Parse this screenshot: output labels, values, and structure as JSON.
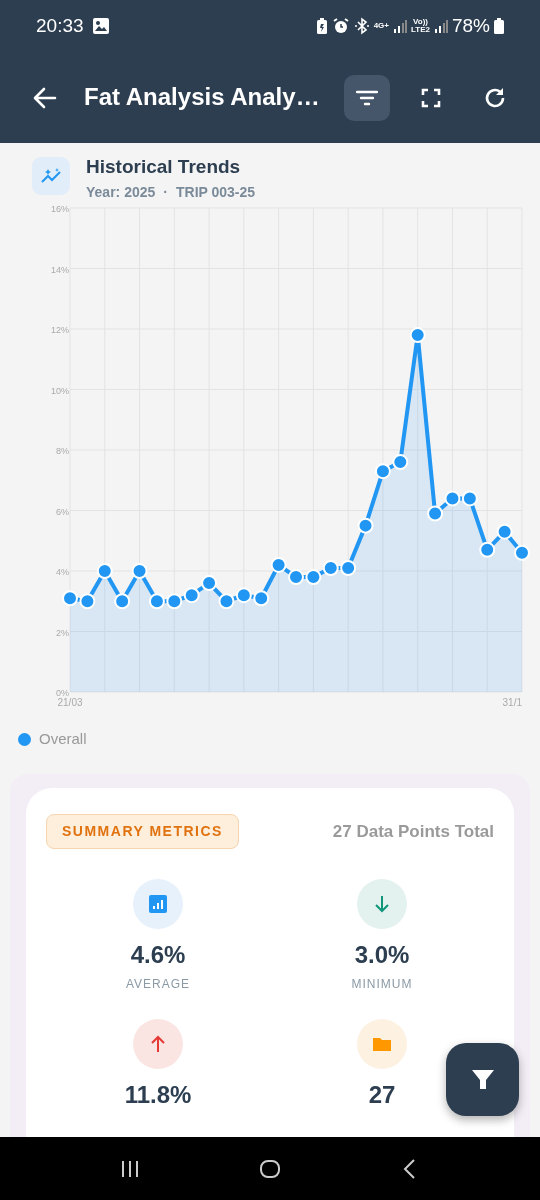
{
  "status_bar": {
    "time": "20:33",
    "network_4g": "4G+",
    "volte_top": "Vo))",
    "volte_bottom": "LTE2",
    "battery": "78%"
  },
  "app_bar": {
    "title": "Fat Analysis Analy…",
    "filter_active": true
  },
  "trends": {
    "title": "Historical Trends",
    "year": "Year: 2025",
    "separator": "·",
    "trip": "TRIP 003-25",
    "x_start_label": "21/03",
    "x_end_label": "31/1",
    "chart_data": {
      "type": "area",
      "grid": true,
      "ylim": [
        0,
        16
      ],
      "yticks": [
        {
          "value": 0,
          "label": "0%"
        },
        {
          "value": 2,
          "label": "2%"
        },
        {
          "value": 4,
          "label": "4%"
        },
        {
          "value": 6,
          "label": "6%"
        },
        {
          "value": 8,
          "label": "8%"
        },
        {
          "value": 10,
          "label": "10%"
        },
        {
          "value": 12,
          "label": "12%"
        },
        {
          "value": 14,
          "label": "14%"
        },
        {
          "value": 16,
          "label": "16%"
        }
      ],
      "series": [
        {
          "name": "Overall",
          "color": "#2196f3",
          "values": [
            3.1,
            3.0,
            4.0,
            3.0,
            4.0,
            3.0,
            3.0,
            3.2,
            3.6,
            3.0,
            3.2,
            3.1,
            4.2,
            3.8,
            3.8,
            4.1,
            4.1,
            5.5,
            7.3,
            7.6,
            11.8,
            5.9,
            6.4,
            6.4,
            4.7,
            5.3,
            4.6
          ]
        }
      ]
    }
  },
  "summary": {
    "badge": "SUMMARY METRICS",
    "total": "27 Data Points Total",
    "metrics": [
      {
        "kind": "average",
        "value": "4.6%",
        "label": "AVERAGE"
      },
      {
        "kind": "minimum",
        "value": "3.0%",
        "label": "MINIMUM"
      },
      {
        "kind": "maximum",
        "value": "11.8%"
      },
      {
        "kind": "count",
        "value": "27"
      }
    ]
  }
}
